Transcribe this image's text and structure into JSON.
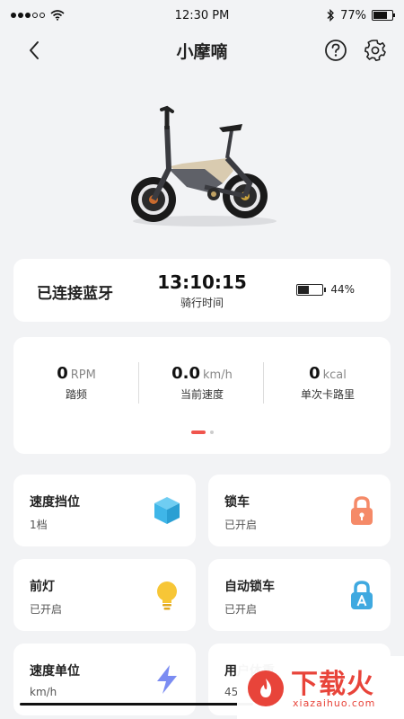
{
  "status_bar": {
    "time": "12:30 PM",
    "battery_text": "77%",
    "battery_level": 0.77,
    "signal_bars": 3
  },
  "nav": {
    "title": "小摩嘀",
    "back_icon": "chevron-left-icon",
    "help_icon": "question-circle-icon",
    "settings_icon": "gear-icon"
  },
  "status_card": {
    "bluetooth_label": "已连接蓝牙",
    "ride_time": "13:10:15",
    "ride_time_label": "骑行时间",
    "battery_text": "44%",
    "battery_level": 0.44
  },
  "stats": {
    "cadence": {
      "value": "0",
      "unit": "RPM",
      "label": "踏频"
    },
    "speed": {
      "value": "0.0",
      "unit": "km/h",
      "label": "当前速度"
    },
    "calories": {
      "value": "0",
      "unit": "kcal",
      "label": "单次卡路里"
    },
    "page_count": 2,
    "active_page": 1
  },
  "tiles": [
    {
      "title": "速度挡位",
      "subtitle": "1档",
      "icon": "cube-icon",
      "color": "#3fb6e8"
    },
    {
      "title": "锁车",
      "subtitle": "已开启",
      "icon": "lock-icon",
      "color": "#f58a68"
    },
    {
      "title": "前灯",
      "subtitle": "已开启",
      "icon": "bulb-icon",
      "color": "#f7c636"
    },
    {
      "title": "自动锁车",
      "subtitle": "已开启",
      "icon": "auto-lock-icon",
      "color": "#3fa9e0"
    },
    {
      "title": "速度单位",
      "subtitle": "km/h",
      "icon": "lightning-icon",
      "color": "#6a7cf0"
    },
    {
      "title": "用户体重",
      "subtitle": "45",
      "icon": "weight-icon",
      "color": "#999999"
    }
  ],
  "watermark": {
    "title": "下载火",
    "subtitle": "xiazaihuo.com",
    "color": "#e8443a"
  }
}
